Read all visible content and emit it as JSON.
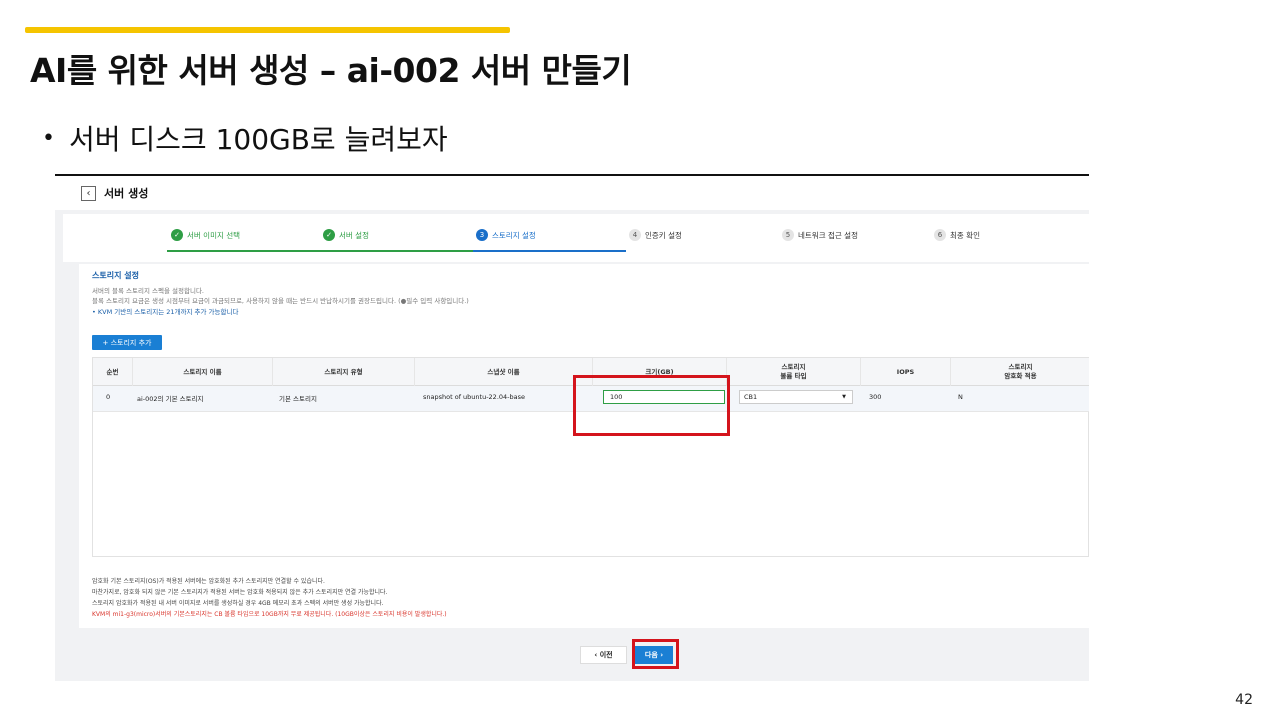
{
  "slide": {
    "title": "AI를 위한 서버 생성 – ai-002 서버 만들기",
    "bullet": "서버 디스크 100GB로 늘려보자",
    "page_number": "42"
  },
  "console": {
    "back_icon": "‹",
    "header_title": "서버 생성",
    "steps": [
      {
        "number": "✓",
        "label": "서버 이미지 선택",
        "state": "done"
      },
      {
        "number": "✓",
        "label": "서버 설정",
        "state": "done"
      },
      {
        "number": "3",
        "label": "스토리지 설정",
        "state": "active"
      },
      {
        "number": "4",
        "label": "인증키 설정",
        "state": "todo"
      },
      {
        "number": "5",
        "label": "네트워크 접근 설정",
        "state": "todo"
      },
      {
        "number": "6",
        "label": "최종 확인",
        "state": "todo"
      }
    ],
    "section_title": "스토리지 설정",
    "desc_lines": [
      "서버의 블록 스토리지 스펙을 설정합니다.",
      "블록 스토리지 요금은 생성 시점부터 요금이 과금되므로, 사용하지 않을 때는 반드시 반납하시기를 권장드립니다. (●필수 입력 사항입니다.)",
      "•  KVM 기반의 스토리지는 21개까지 추가 가능합니다"
    ],
    "add_button": "+ 스토리지 추가",
    "columns": [
      "순번",
      "스토리지 이름",
      "스토리지 유형",
      "스냅샷 이름",
      "크기(GB)",
      "스토리지\n볼륨 타입",
      "IOPS",
      "스토리지\n암호화 적용"
    ],
    "row": {
      "index": "0",
      "name": "ai-002의 기본 스토리지",
      "type": "기본 스토리지",
      "snapshot": "snapshot of ubuntu-22.04-base",
      "size": "100",
      "volume_type": "CB1",
      "iops": "300",
      "encryption": "N"
    },
    "notes": [
      "암호화 기본 스토리지(OS)가 적용된 서버에는 암호화된 추가 스토리지만 연결할 수 있습니다.",
      "마찬가지로, 암호화 되지 않은 기본 스토리지가 적용된 서버는 암호화 적용되지 않은 추가 스토리지만 연결 가능합니다.",
      "스토리지 암호화가 적용된 내 서버 이미지로 서버를 생성하실 경우 4GB 메모리 초과 스펙의 서버만 생성 가능합니다."
    ],
    "note_red": "KVM의 mi1-g3(micro)서버의 기본스토리지는 CB 볼륨 타입으로 10GB까지 무료 제공됩니다. (10GB이상은 스토리지 비용이 발생합니다.)",
    "prev_button": "‹  이전",
    "next_button": "다음  ›"
  },
  "colors": {
    "accent": "#f5c400",
    "highlight": "#d4141c",
    "primary": "#1a7fd4",
    "done": "#2e9e45"
  }
}
